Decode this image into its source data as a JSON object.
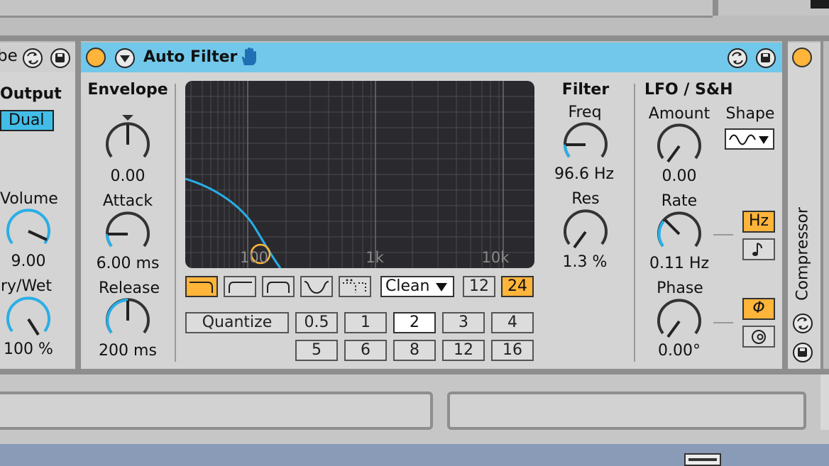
{
  "prev_device": {
    "title_fragment": "be",
    "output_label": "Output",
    "mode_value": "Dual",
    "volume_label": "Volume",
    "volume_value": "9.00",
    "drywet_label": "Dry/Wet",
    "drywet_value": "100 %"
  },
  "device": {
    "title": "Auto Filter",
    "envelope": {
      "label": "Envelope",
      "amount_value": "0.00",
      "attack_label": "Attack",
      "attack_value": "6.00 ms",
      "release_label": "Release",
      "release_value": "200 ms"
    },
    "display": {
      "tick_labels": [
        "100",
        "1k",
        "10k"
      ]
    },
    "filter_types": [
      "lowpass-icon",
      "highpass-icon",
      "bandpass-icon",
      "notch-icon",
      "morph-icon"
    ],
    "circuit": {
      "value": "Clean"
    },
    "slopes": [
      "12",
      "24"
    ],
    "quantize": {
      "label": "Quantize",
      "row1": [
        "0.5",
        "1",
        "2",
        "3",
        "4"
      ],
      "row2": [
        "5",
        "6",
        "8",
        "12",
        "16"
      ]
    },
    "filter": {
      "label": "Filter",
      "freq_label": "Freq",
      "freq_value": "96.6 Hz",
      "res_label": "Res",
      "res_value": "1.3 %"
    },
    "lfo": {
      "label": "LFO / S&H",
      "amount_label": "Amount",
      "amount_value": "0.00",
      "shape_label": "Shape",
      "rate_label": "Rate",
      "rate_value": "0.11 Hz",
      "rate_unit": "Hz",
      "phase_label": "Phase",
      "phase_value": "0.00°",
      "phase_mode": "Φ"
    }
  },
  "next_device": {
    "title": "Compressor"
  },
  "colors": {
    "accent": "#ffb43a",
    "title_bar": "#71c8ea",
    "knob_arc": "#29aee6",
    "display_bg": "#2a2a2e"
  }
}
